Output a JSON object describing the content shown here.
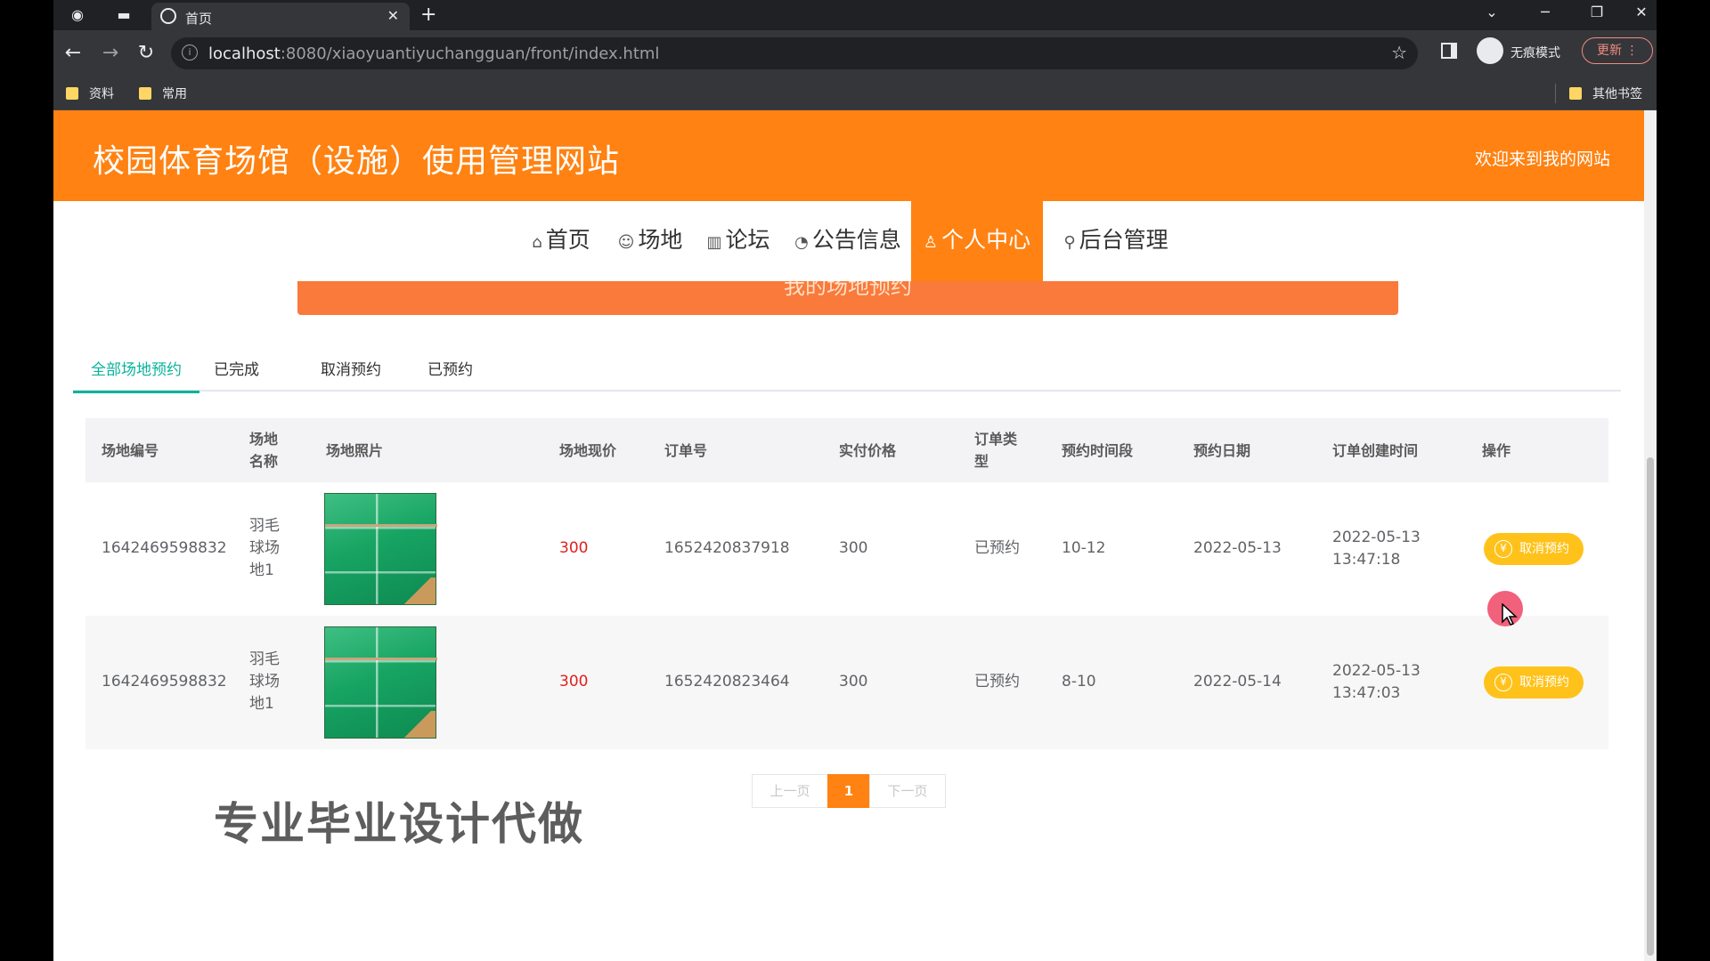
{
  "browser": {
    "tab_title": "首页",
    "new_tab": "+",
    "url_host": "localhost",
    "url_rest": ":8080/xiaoyuantiyuchangguan/front/index.html",
    "incognito_label": "无痕模式",
    "update_label": "更新",
    "bookmarks": [
      "资料",
      "常用"
    ],
    "other_bookmarks": "其他书签"
  },
  "site": {
    "title": "校园体育场馆（设施）使用管理网站",
    "welcome": "欢迎来到我的网站",
    "accent_color": "#ff8212"
  },
  "nav": {
    "items": [
      {
        "icon": "home-icon",
        "label": "首页"
      },
      {
        "icon": "venue-icon",
        "label": "场地"
      },
      {
        "icon": "forum-icon",
        "label": "论坛"
      },
      {
        "icon": "notice-icon",
        "label": "公告信息"
      },
      {
        "icon": "user-icon",
        "label": "个人中心"
      },
      {
        "icon": "link-icon",
        "label": "后台管理"
      }
    ],
    "active": "个人中心"
  },
  "banner": {
    "title": "我的场地预约"
  },
  "tabs": {
    "items": [
      "全部场地预约",
      "已完成",
      "取消预约",
      "已预约"
    ],
    "active": "全部场地预约",
    "active_color": "#09b39a"
  },
  "table": {
    "headers": {
      "venue_no": "场地编号",
      "venue_name": "场地名称",
      "photo": "场地照片",
      "price_now": "场地现价",
      "order_no": "订单号",
      "paid": "实付价格",
      "order_type": "订单类型",
      "time_slot": "预约时间段",
      "date": "预约日期",
      "created": "订单创建时间",
      "action": "操作"
    },
    "rows": [
      {
        "venue_no": "1642469598832",
        "venue_name": "羽毛球场地1",
        "price_now": "300",
        "order_no": "1652420837918",
        "paid": "300",
        "order_type": "已预约",
        "time_slot": "10-12",
        "date": "2022-05-13",
        "created_date": "2022-05-13",
        "created_time": "13:47:18",
        "action": "取消预约"
      },
      {
        "venue_no": "1642469598832",
        "venue_name": "羽毛球场地1",
        "price_now": "300",
        "order_no": "1652420823464",
        "paid": "300",
        "order_type": "已预约",
        "time_slot": "8-10",
        "date": "2022-05-14",
        "created_date": "2022-05-13",
        "created_time": "13:47:03",
        "action": "取消预约"
      }
    ]
  },
  "pager": {
    "prev": "上一页",
    "current": "1",
    "next": "下一页"
  },
  "watermark": "专业毕业设计代做"
}
